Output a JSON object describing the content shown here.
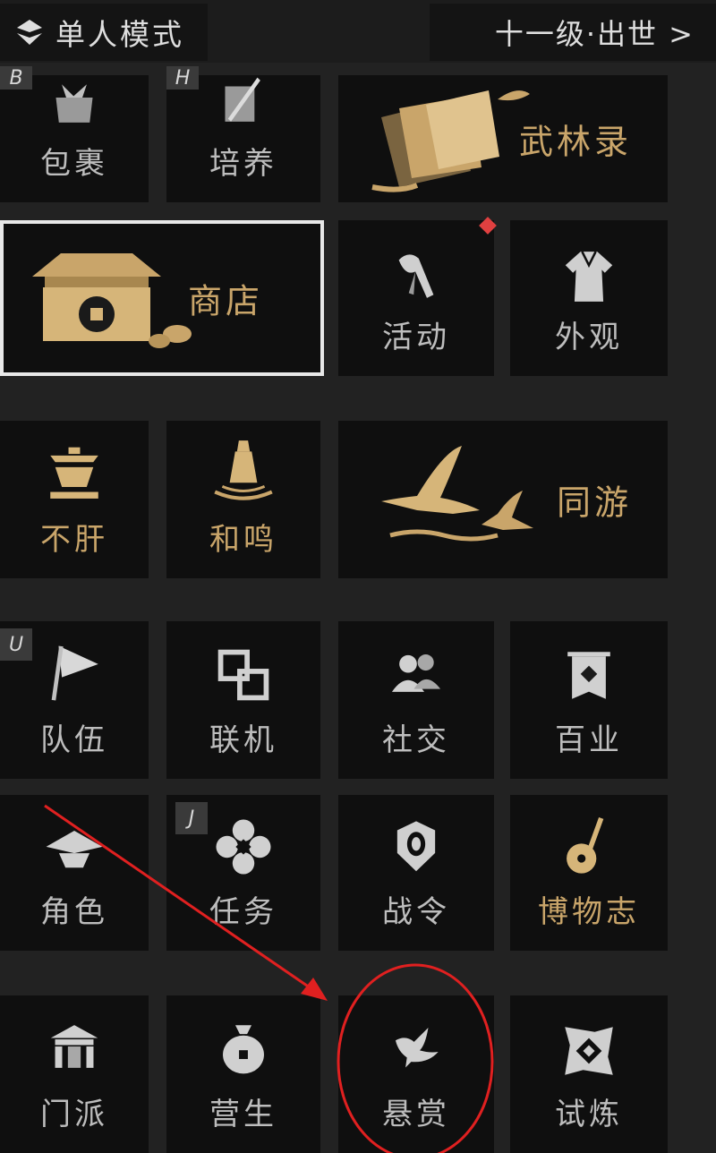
{
  "header": {
    "mode_label": "单人模式",
    "level_label": "十一级·出世 >"
  },
  "tiles": {
    "baoguo": {
      "label": "包裹",
      "key": "B"
    },
    "peiyang": {
      "label": "培养",
      "key": "H"
    },
    "wulinlu": {
      "label": "武林录"
    },
    "shangdian": {
      "label": "商店"
    },
    "huodong": {
      "label": "活动"
    },
    "waiguan": {
      "label": "外观"
    },
    "bugan": {
      "label": "不肝"
    },
    "heming": {
      "label": "和鸣"
    },
    "tongyou": {
      "label": "同游"
    },
    "duiwu": {
      "label": "队伍",
      "key": "U"
    },
    "lianji": {
      "label": "联机"
    },
    "shejiao": {
      "label": "社交"
    },
    "baiye": {
      "label": "百业"
    },
    "juese": {
      "label": "角色"
    },
    "renwu": {
      "label": "任务",
      "key": "J"
    },
    "zhanling": {
      "label": "战令"
    },
    "bowuzhi": {
      "label": "博物志"
    },
    "menpai": {
      "label": "门派"
    },
    "yingsheng": {
      "label": "营生"
    },
    "xuanshang": {
      "label": "悬赏"
    },
    "shilian": {
      "label": "试炼"
    }
  },
  "colors": {
    "gold": "#c9a56a",
    "text": "#bdbdbd",
    "tile_bg": "#0f0f0f",
    "page_bg": "#222222",
    "notification": "#e04040",
    "annotation_red": "#e02020"
  }
}
